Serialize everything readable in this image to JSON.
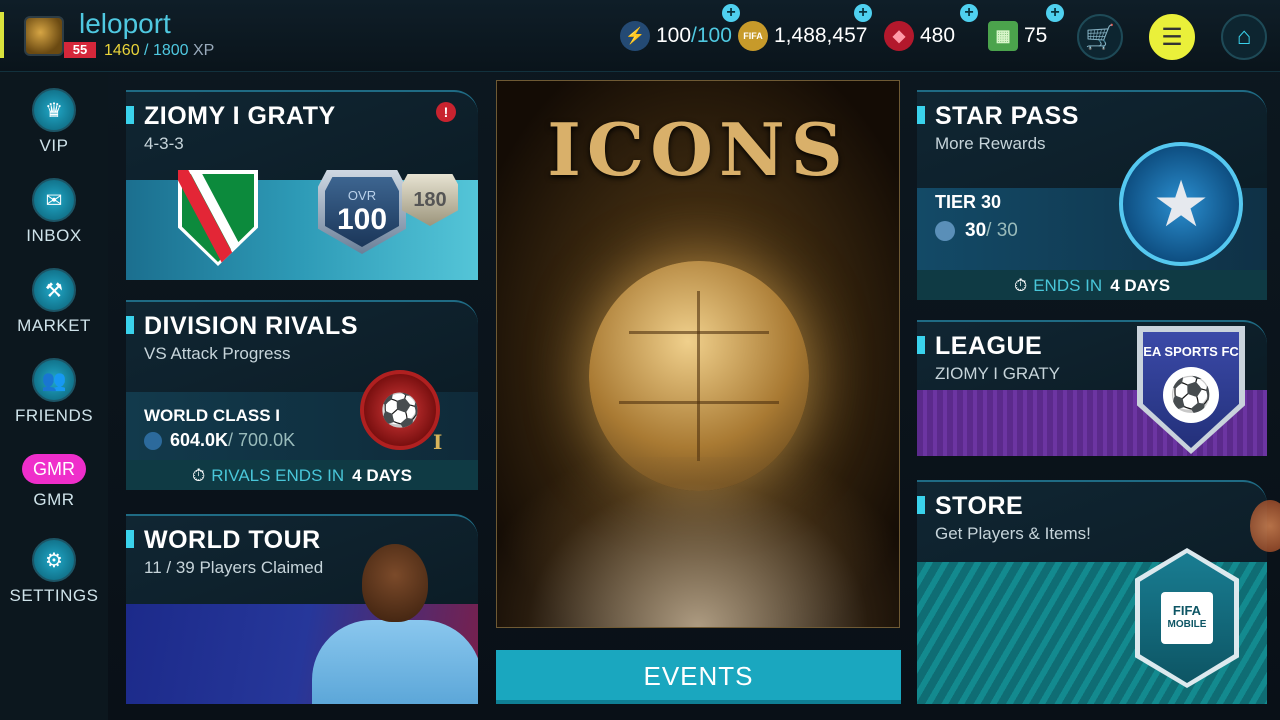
{
  "profile": {
    "username": "leloport",
    "level": "55",
    "xp_current": "1460",
    "xp_sep": " / ",
    "xp_max": "1800",
    "xp_unit": "XP"
  },
  "currencies": {
    "stamina": {
      "value": "100",
      "max": "/100",
      "icon": "lightning-icon"
    },
    "coins": {
      "value": "1,488,457",
      "icon": "fifa-coin-icon"
    },
    "gems": {
      "value": "480",
      "icon": "gem-icon"
    },
    "cash": {
      "value": "75",
      "icon": "cash-icon"
    }
  },
  "sidebar": [
    {
      "label": "VIP",
      "icon": "crown-icon",
      "glyph": "♛"
    },
    {
      "label": "INBOX",
      "icon": "envelope-icon",
      "glyph": "✉"
    },
    {
      "label": "MARKET",
      "icon": "gavel-icon",
      "glyph": "⚒"
    },
    {
      "label": "FRIENDS",
      "icon": "friends-icon",
      "glyph": "👥"
    },
    {
      "label": "GMR",
      "pill": "GMR"
    },
    {
      "label": "SETTINGS",
      "icon": "gear-icon",
      "glyph": "⚙"
    }
  ],
  "cards": {
    "ziomy": {
      "title": "ZIOMY I GRATY",
      "sub": "4-3-3",
      "ovr_label": "OVR",
      "ovr_value": "100",
      "rating_small": "180",
      "alert": "!"
    },
    "rivals": {
      "title": "DIVISION RIVALS",
      "sub": "VS Attack Progress",
      "rank": "WORLD CLASS I",
      "progress_value": "604.0K",
      "progress_max": " / 700.0K",
      "rank_roman": "I",
      "timer_label": "RIVALS ENDS IN",
      "timer_value": "4 DAYS"
    },
    "tour": {
      "title": "WORLD TOUR",
      "sub": "11 / 39 Players Claimed"
    },
    "starpass": {
      "title": "STAR PASS",
      "sub": "More Rewards",
      "tier": "TIER 30",
      "tier_value": "30",
      "tier_max": " / 30",
      "timer_label": "ENDS IN",
      "timer_value": "4 DAYS"
    },
    "league": {
      "title": "LEAGUE",
      "sub": "ZIOMY I GRATY",
      "crest_text": "EA SPORTS FC"
    },
    "store": {
      "title": "STORE",
      "sub": "Get Players & Items!",
      "logo_text_1": "FIFA",
      "logo_text_2": "MOBILE"
    }
  },
  "banner": {
    "title": "ICONS"
  },
  "events_button": "EVENTS",
  "colors": {
    "accent": "#3ad2ec",
    "xp": "#e9d43a",
    "gmr": "#ef2ecb",
    "events": "#1aa7bf"
  }
}
